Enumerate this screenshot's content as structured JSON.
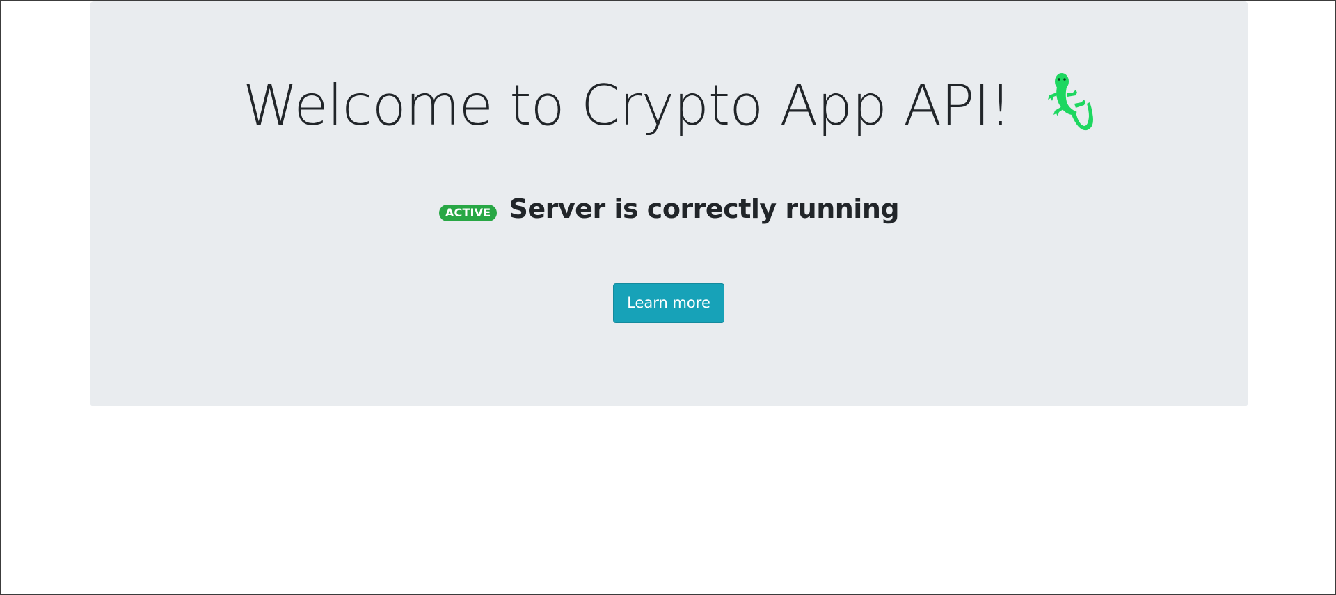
{
  "jumbotron": {
    "title": "Welcome to Crypto App API!",
    "title_icon": "lizard-icon",
    "status_badge": "ACTIVE",
    "status_text": "Server is correctly running",
    "learn_more_label": "Learn more"
  },
  "colors": {
    "jumbotron_bg": "#e9ecef",
    "badge_success": "#28a745",
    "button_info": "#17a2b8",
    "lizard_green": "#1ed760",
    "text_dark": "#212529"
  }
}
